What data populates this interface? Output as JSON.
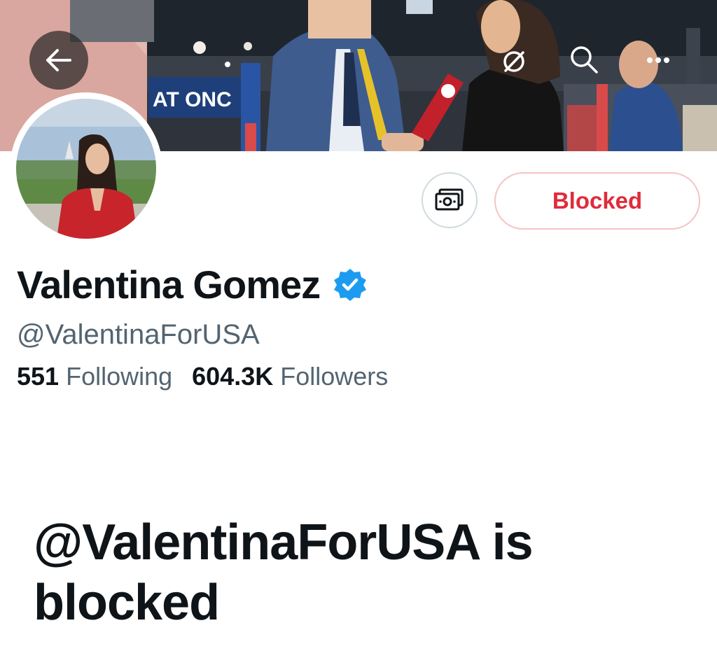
{
  "header": {
    "back_icon": "arrow-left-icon",
    "grok_icon": "grok-icon",
    "search_icon": "search-icon",
    "more_icon": "more-icon",
    "banner_sign_text": "AT ONC"
  },
  "profile": {
    "display_name": "Valentina Gomez",
    "verified": true,
    "verified_color": "#1d9bf0",
    "handle": "@ValentinaForUSA",
    "following_count": "551",
    "following_label": "Following",
    "followers_count": "604.3K",
    "followers_label": "Followers"
  },
  "actions": {
    "tip_icon": "money-icon",
    "blocked_label": "Blocked",
    "blocked_color": "#e02b3b"
  },
  "blocked_notice": {
    "title": "@ValentinaForUSA is blocked"
  }
}
